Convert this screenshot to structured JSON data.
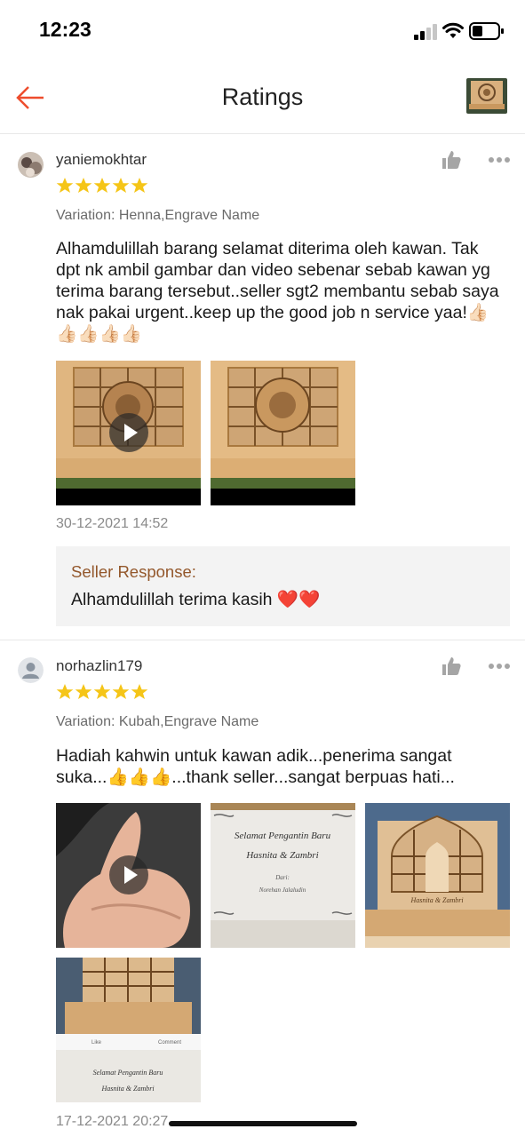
{
  "status_bar": {
    "time": "12:23"
  },
  "header": {
    "title": "Ratings",
    "back_icon": "arrow-left-icon"
  },
  "colors": {
    "accent": "#ee4d2d",
    "star": "#f5c518",
    "seller_title": "#93572b"
  },
  "reviews": [
    {
      "username": "yaniemokhtar",
      "rating": 5,
      "variation": "Variation: Henna,Engrave Name",
      "comment": "Alhamdulillah barang selamat diterima oleh kawan. Tak dpt nk ambil gambar dan video sebenar sebab kawan yg terima barang tersebut..seller sgt2 membantu sebab saya nak pakai urgent..keep up the good job n service yaa!👍🏻👍🏻👍🏻👍🏻👍🏻",
      "media": [
        "video",
        "image"
      ],
      "timestamp": "30-12-2021 14:52",
      "seller_response": {
        "title": "Seller Response:",
        "text": "Alhamdulillah terima kasih ❤️❤️"
      }
    },
    {
      "username": "norhazlin179",
      "rating": 5,
      "variation": "Variation: Kubah,Engrave Name",
      "comment": "Hadiah kahwin untuk kawan adik...penerima sangat suka...👍👍👍...thank seller...sangat berpuas hati...",
      "media": [
        "video",
        "image",
        "image",
        "image"
      ],
      "timestamp": "17-12-2021 20:27",
      "card_text": {
        "line1": "Selamat Pengantin Baru",
        "line2": "Hasnita & Zambri",
        "line3": "Dari:",
        "line4": "Norehan Jalaludin"
      },
      "stand_text": "Hasnita & Zambri",
      "fb_labels": {
        "like": "Like",
        "comment": "Comment"
      }
    }
  ]
}
